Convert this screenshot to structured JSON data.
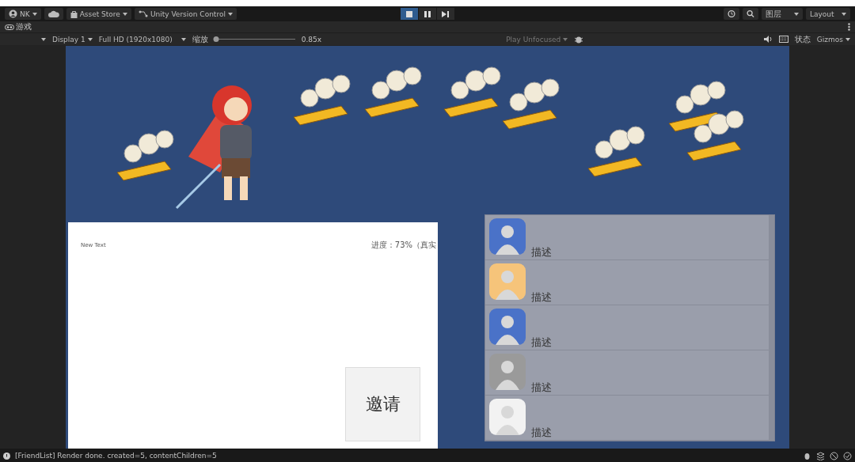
{
  "toolbar": {
    "account": "NK",
    "asset_store": "Asset Store",
    "version_control": "Unity Version Control",
    "play_controls": [
      {
        "kind": "play",
        "selected": true
      },
      {
        "kind": "pause",
        "selected": false
      },
      {
        "kind": "step",
        "selected": false
      }
    ],
    "layers": "图层",
    "layout": "Layout"
  },
  "tab": {
    "label": "游戏"
  },
  "game_toolbar": {
    "display": "Display 1",
    "resolution": "Full HD (1920x1080)",
    "scale_label": "缩放",
    "scale": {
      "level": 0.0
    },
    "scale_reading": "0.85x",
    "play_mode": "Play Unfocused",
    "stats": "状态",
    "gizmos": "Gizmos"
  },
  "game": {
    "panel_text": "New Text",
    "progress_text": "进度：73%（真实",
    "invite_button": "邀请",
    "friends": [
      {
        "description": "描述",
        "color": "#4a72c8"
      },
      {
        "description": "描述",
        "color": "#f6c47a"
      },
      {
        "description": "描述",
        "color": "#4a72c8"
      },
      {
        "description": "描述",
        "color": "#9a9a9a"
      },
      {
        "description": "描述",
        "color": "#f2f2f2"
      }
    ]
  },
  "status_bar": {
    "message": "[FriendList] Render done. created=5, contentChildren=5"
  }
}
